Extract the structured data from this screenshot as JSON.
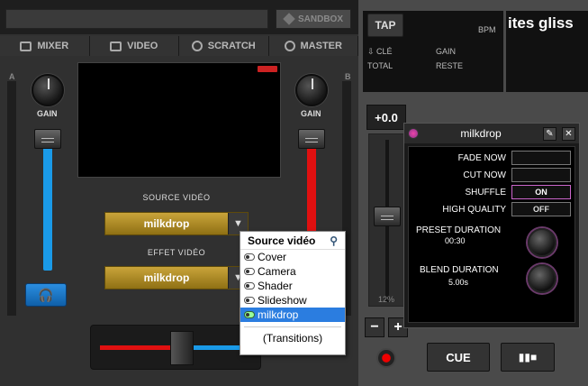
{
  "left": {
    "sandbox_label": "SANDBOX",
    "tabs": [
      {
        "label": "MIXER",
        "icon": "mixer-icon"
      },
      {
        "label": "VIDEO",
        "icon": "video-icon"
      },
      {
        "label": "SCRATCH",
        "icon": "scratch-icon"
      },
      {
        "label": "MASTER",
        "icon": "master-icon"
      }
    ],
    "channel_a": "A",
    "channel_b": "B",
    "gain_label": "GAIN",
    "source_label": "SOURCE VIDÉO",
    "source_value": "milkdrop",
    "effect_label": "EFFET VIDÉO",
    "effect_value": "milkdrop"
  },
  "popup": {
    "title": "Source vidéo",
    "items": [
      "Cover",
      "Camera",
      "Shader",
      "Slideshow",
      "milkdrop"
    ],
    "selected": "milkdrop",
    "transitions": "(Transitions)"
  },
  "deck": {
    "tap": "TAP",
    "bpm": "BPM",
    "key": "CLÉ",
    "gain": "GAIN",
    "total": "TOTAL",
    "remain": "RESTE",
    "title": "ites gliss",
    "pitch": "+0.0",
    "pitch_range": "12%",
    "cue": "CUE",
    "minus": "−",
    "plus": "+"
  },
  "plugin": {
    "name": "milkdrop",
    "fade_now": "FADE NOW",
    "cut_now": "CUT NOW",
    "shuffle": "SHUFFLE",
    "shuffle_state": "ON",
    "high_quality": "HIGH QUALITY",
    "hq_state": "OFF",
    "preset_duration": "PRESET DURATION",
    "preset_value": "00:30",
    "blend_duration": "BLEND DURATION",
    "blend_value": "5.00s"
  },
  "colors": {
    "accent_gold": "#c9a43a",
    "headphone_blue": "#2b8ee0",
    "fader_red": "#e01010",
    "fader_blue": "#1a9ae8",
    "selected_blue": "#2b7de0"
  }
}
